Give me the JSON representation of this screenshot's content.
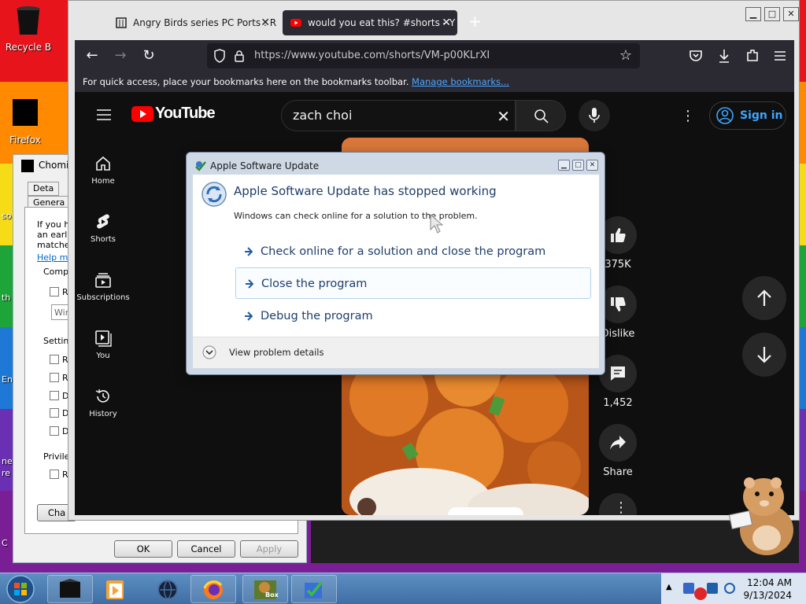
{
  "desktop": {
    "icons": [
      {
        "label": "Recycle B"
      },
      {
        "label": "Firefox"
      }
    ],
    "edge_text": [
      "so",
      "th",
      "En",
      "ne",
      "re",
      "C"
    ]
  },
  "firefox": {
    "tabs": [
      {
        "title": "Angry Birds series PC Ports : Re",
        "close": "✕"
      },
      {
        "title": "would you eat this? #shorts - Y",
        "close": "✕"
      }
    ],
    "new_tab": "+",
    "url": "https://www.youtube.com/shorts/VM-p00KLrXI",
    "bookmarks_text": "For quick access, place your bookmarks here on the bookmarks toolbar.",
    "bookmarks_link": "Manage bookmarks..."
  },
  "youtube": {
    "logo_text": "YouTube",
    "search_value": "zach choi",
    "sign_in": "Sign in",
    "sidebar": [
      {
        "label": "Home",
        "icon": "home-icon"
      },
      {
        "label": "Shorts",
        "icon": "shorts-icon"
      },
      {
        "label": "Subscriptions",
        "icon": "subscriptions-icon"
      },
      {
        "label": "You",
        "icon": "you-icon"
      },
      {
        "label": "History",
        "icon": "history-icon"
      }
    ],
    "actions": {
      "like_count": "375K",
      "dislike_label": "Dislike",
      "comments_count": "1,452",
      "share_label": "Share"
    }
  },
  "properties_dialog": {
    "title": "Chomil",
    "tabs": [
      "Deta",
      "Genera"
    ],
    "intro_lines": [
      "If you ha",
      "an earlie",
      "matches"
    ],
    "help_link": "Help m",
    "groups": [
      "Compa",
      "Setting",
      "Privileg"
    ],
    "checkbox_labels": [
      "R",
      "R",
      "R",
      "D",
      "D",
      "D",
      "R"
    ],
    "select_value": "Win",
    "change_button": "Cha",
    "ok": "OK",
    "cancel": "Cancel",
    "apply": "Apply"
  },
  "error_dialog": {
    "title": "Apple Software Update",
    "headline": "Apple Software Update has stopped working",
    "subtext": "Windows can check online for a solution to the problem.",
    "options": [
      "Check online for a solution and close the program",
      "Close the program",
      "Debug the program"
    ],
    "details": "View problem details"
  },
  "taskbar": {
    "time": "12:04 AM",
    "date": "9/13/2024",
    "box_label": "Box"
  },
  "colors": {
    "yt_red": "#ff0000",
    "yt_link": "#3ea6ff",
    "dialog_text": "#1e3e6b"
  }
}
